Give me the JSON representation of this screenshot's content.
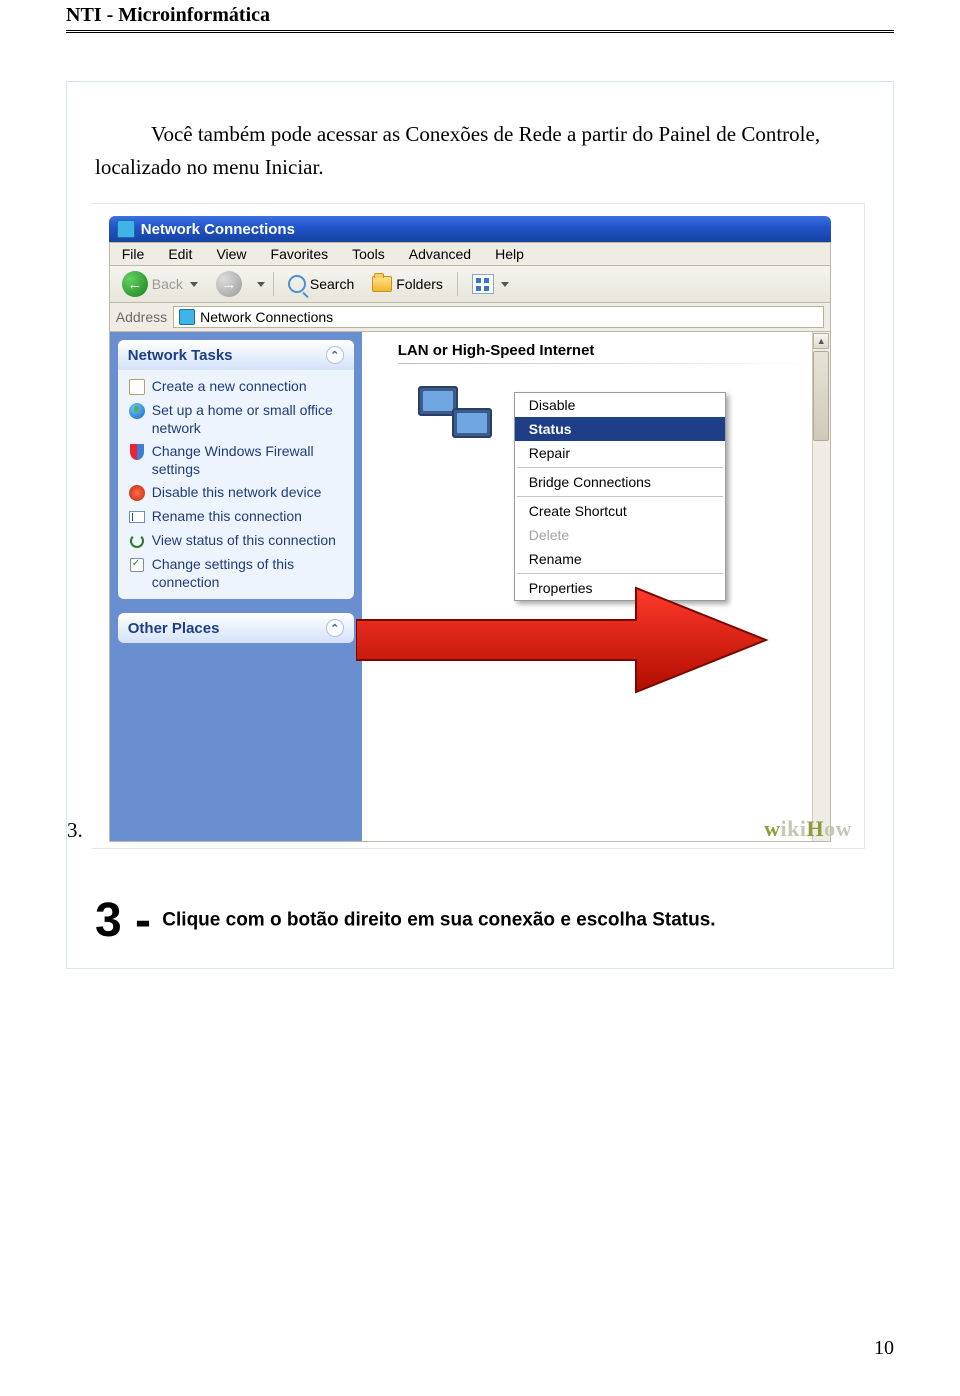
{
  "header": {
    "title": "NTI - Microinformática"
  },
  "intro": "Você também pode acessar as Conexões de Rede a partir do Painel de Controle, localizado no menu Iniciar.",
  "list_number": "3.",
  "screenshot": {
    "titlebar": "Network Connections",
    "menu": [
      "File",
      "Edit",
      "View",
      "Favorites",
      "Tools",
      "Advanced",
      "Help"
    ],
    "toolbar": {
      "back": "Back",
      "search": "Search",
      "folders": "Folders"
    },
    "address": {
      "label": "Address",
      "value": "Network Connections"
    },
    "sidebar": {
      "tasks_title": "Network Tasks",
      "tasks": [
        "Create a new connection",
        "Set up a home or small office network",
        "Change Windows Firewall settings",
        "Disable this network device",
        "Rename this connection",
        "View status of this connection",
        "Change settings of this connection"
      ],
      "other_title": "Other Places"
    },
    "main": {
      "section": "LAN or High-Speed Internet"
    },
    "context_menu": {
      "items": [
        "Disable",
        "Status",
        "Repair",
        "Bridge Connections",
        "Create Shortcut",
        "Delete",
        "Rename",
        "Properties"
      ],
      "selected": "Status",
      "disabled": [
        "Delete"
      ]
    },
    "watermark": "wikiHow"
  },
  "step3": {
    "num": "3 -",
    "text": "Clique com o botão direito em sua conexão e escolha Status."
  },
  "page_number": "10"
}
